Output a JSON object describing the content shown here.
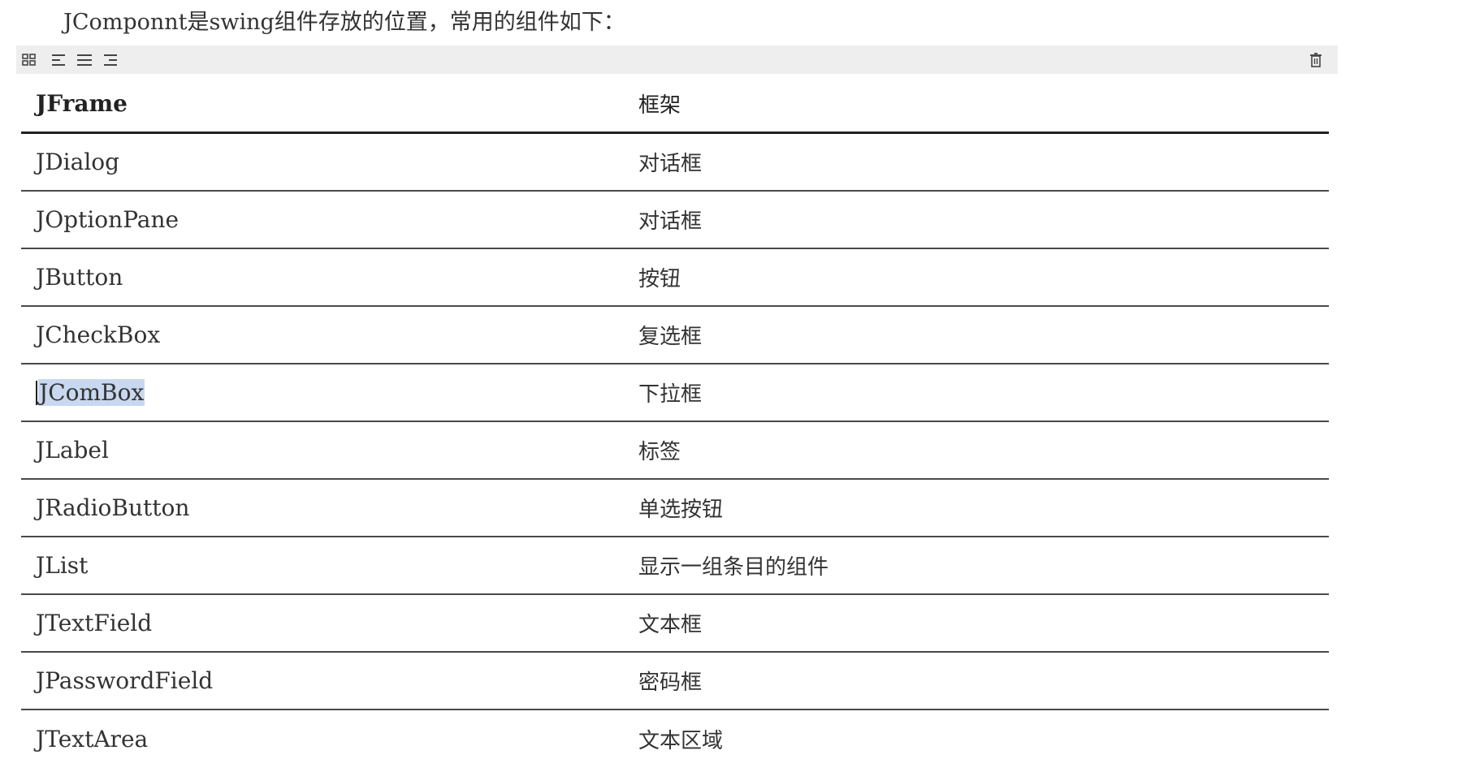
{
  "intro_text": "JComponnt是swing组件存放的位置，常用的组件如下：",
  "toolbar": {
    "icons": [
      "table-grid-icon",
      "align-left-icon",
      "align-center-icon",
      "align-right-icon",
      "trash-icon"
    ]
  },
  "table": {
    "header": {
      "name": "JFrame",
      "desc": "框架"
    },
    "rows": [
      {
        "name": "JDialog",
        "desc": "对话框"
      },
      {
        "name": "JOptionPane",
        "desc": "对话框"
      },
      {
        "name": "JButton",
        "desc": "按钮"
      },
      {
        "name": "JCheckBox",
        "desc": "复选框"
      },
      {
        "name": "JComBox",
        "desc": "下拉框"
      },
      {
        "name": "JLabel",
        "desc": "标签"
      },
      {
        "name": "JRadioButton",
        "desc": "单选按钮"
      },
      {
        "name": "JList",
        "desc": "显示一组条目的组件"
      },
      {
        "name": "JTextField",
        "desc": "文本框"
      },
      {
        "name": "JPasswordField",
        "desc": "密码框"
      },
      {
        "name": "JTextArea",
        "desc": "文本区域"
      }
    ]
  },
  "colors": {
    "toolbar_bg": "#eeeeee",
    "selection": "#c8d8f0",
    "rule": "#4a4a4a"
  }
}
